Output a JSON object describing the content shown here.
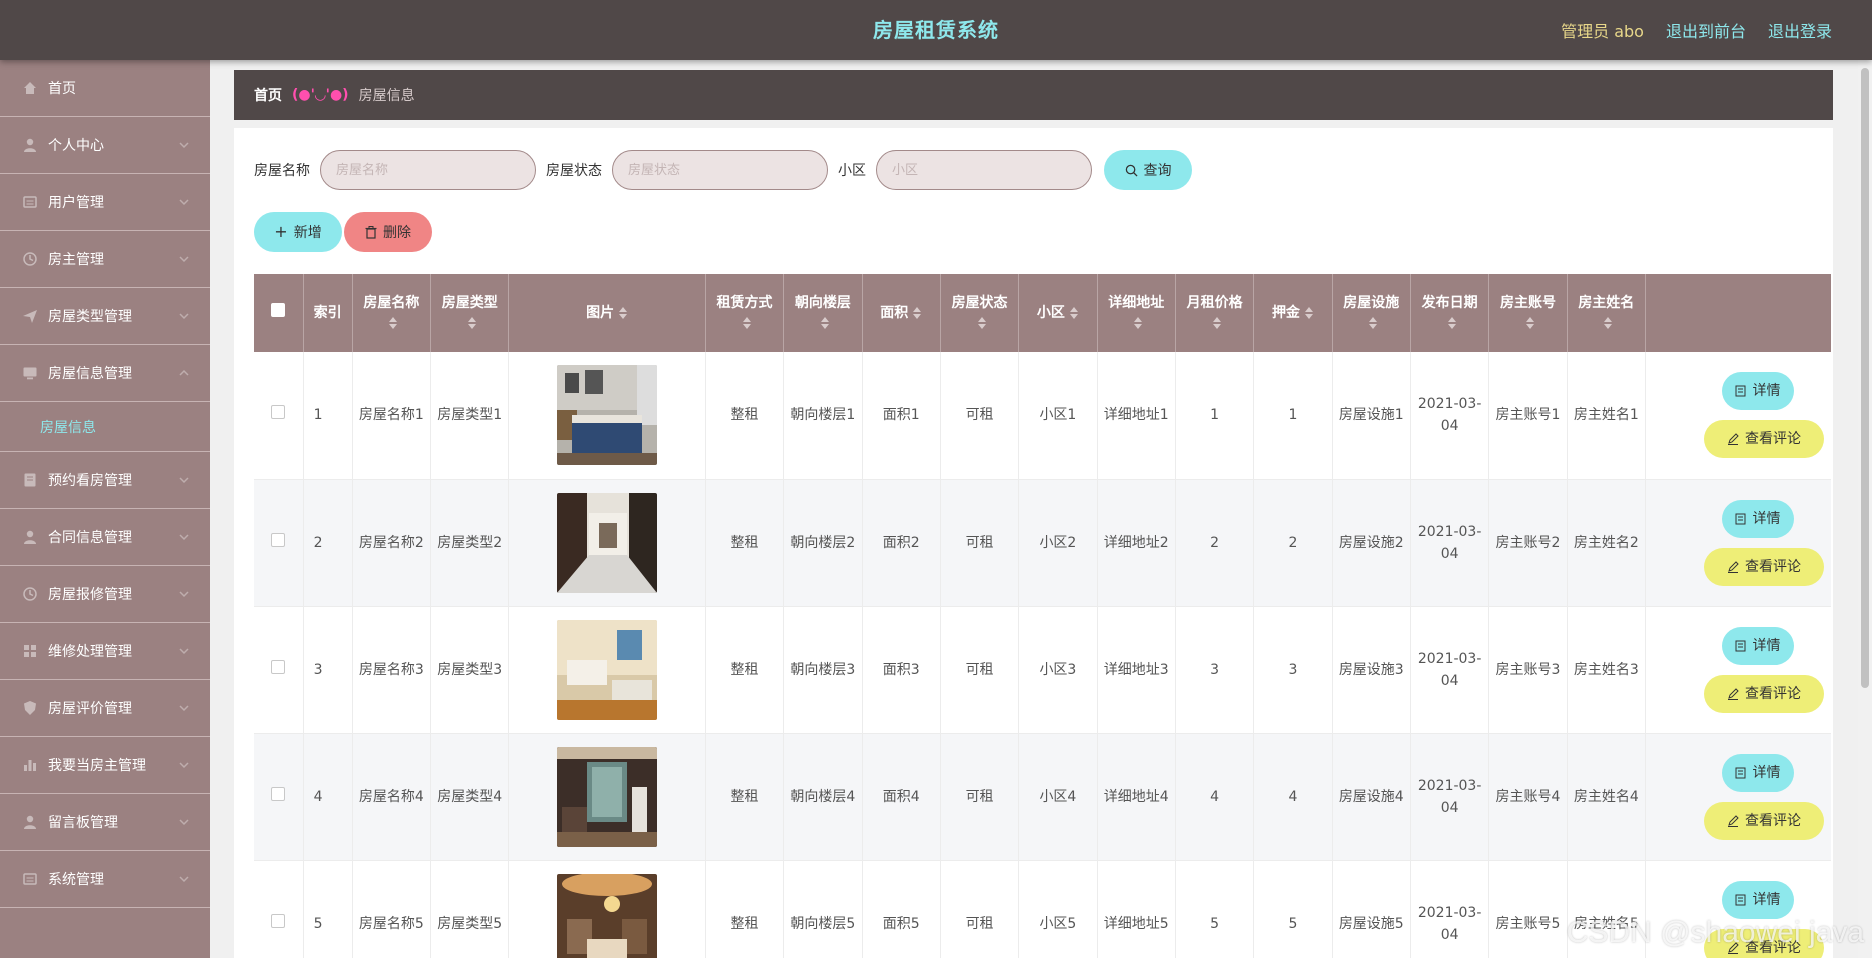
{
  "header": {
    "title": "房屋租赁系统",
    "admin_role": "管理员",
    "admin_name": "abo",
    "link_front": "退出到前台",
    "link_logout": "退出登录"
  },
  "colors": {
    "header_bg": "#504848",
    "accent_cyan": "#8ee8ec",
    "sidebar_bg": "#9b8181",
    "delete_red": "#f08585",
    "review_yellow": "#eeee77"
  },
  "sidebar": {
    "items": [
      {
        "label": "首页",
        "icon": "home-icon"
      },
      {
        "label": "个人中心",
        "icon": "user-icon"
      },
      {
        "label": "用户管理",
        "icon": "list-icon"
      },
      {
        "label": "房主管理",
        "icon": "clock-icon"
      },
      {
        "label": "房屋类型管理",
        "icon": "send-icon"
      },
      {
        "label": "房屋信息管理",
        "icon": "monitor-icon",
        "sub": "房屋信息"
      },
      {
        "label": "预约看房管理",
        "icon": "book-icon"
      },
      {
        "label": "合同信息管理",
        "icon": "user-icon"
      },
      {
        "label": "房屋报修管理",
        "icon": "clock-icon"
      },
      {
        "label": "维修处理管理",
        "icon": "grid-icon"
      },
      {
        "label": "房屋评价管理",
        "icon": "shield-icon"
      },
      {
        "label": "我要当房主管理",
        "icon": "bar-chart-icon"
      },
      {
        "label": "留言板管理",
        "icon": "user-icon"
      },
      {
        "label": "系统管理",
        "icon": "list-icon"
      }
    ]
  },
  "breadcrumb": {
    "home": "首页",
    "separator": "(●'◡'●)",
    "current": "房屋信息"
  },
  "search": {
    "name_label": "房屋名称",
    "name_placeholder": "房屋名称",
    "status_label": "房屋状态",
    "status_placeholder": "房屋状态",
    "community_label": "小区",
    "community_placeholder": "小区",
    "query_label": "查询"
  },
  "actions": {
    "add_label": "新增",
    "delete_label": "删除"
  },
  "table": {
    "headers": [
      "索引",
      "房屋名称",
      "房屋类型",
      "图片",
      "租赁方式",
      "朝向楼层",
      "面积",
      "房屋状态",
      "小区",
      "详细地址",
      "月租价格",
      "押金",
      "房屋设施",
      "发布日期",
      "房主账号",
      "房主姓名"
    ],
    "detail_label": "详情",
    "review_label": "查看评论",
    "rows": [
      {
        "index": "1",
        "name": "房屋名称1",
        "type": "房屋类型1",
        "image": "bedroom",
        "rent": "整租",
        "floor": "朝向楼层1",
        "area": "面积1",
        "status": "可租",
        "community": "小区1",
        "address": "详细地址1",
        "price": "1",
        "deposit": "1",
        "facility": "房屋设施1",
        "date": "2021-03-04",
        "owner_account": "房主账号1",
        "owner_name": "房主姓名1"
      },
      {
        "index": "2",
        "name": "房屋名称2",
        "type": "房屋类型2",
        "image": "hallway",
        "rent": "整租",
        "floor": "朝向楼层2",
        "area": "面积2",
        "status": "可租",
        "community": "小区2",
        "address": "详细地址2",
        "price": "2",
        "deposit": "2",
        "facility": "房屋设施2",
        "date": "2021-03-04",
        "owner_account": "房主账号2",
        "owner_name": "房主姓名2"
      },
      {
        "index": "3",
        "name": "房屋名称3",
        "type": "房屋类型3",
        "image": "hotel-room",
        "rent": "整租",
        "floor": "朝向楼层3",
        "area": "面积3",
        "status": "可租",
        "community": "小区3",
        "address": "详细地址3",
        "price": "3",
        "deposit": "3",
        "facility": "房屋设施3",
        "date": "2021-03-04",
        "owner_account": "房主账号3",
        "owner_name": "房主姓名3"
      },
      {
        "index": "4",
        "name": "房屋名称4",
        "type": "房屋类型4",
        "image": "living-room",
        "rent": "整租",
        "floor": "朝向楼层4",
        "area": "面积4",
        "status": "可租",
        "community": "小区4",
        "address": "详细地址4",
        "price": "4",
        "deposit": "4",
        "facility": "房屋设施4",
        "date": "2021-03-04",
        "owner_account": "房主账号4",
        "owner_name": "房主姓名4"
      },
      {
        "index": "5",
        "name": "房屋名称5",
        "type": "房屋类型5",
        "image": "chandelier-room",
        "rent": "整租",
        "floor": "朝向楼层5",
        "area": "面积5",
        "status": "可租",
        "community": "小区5",
        "address": "详细地址5",
        "price": "5",
        "deposit": "5",
        "facility": "房屋设施5",
        "date": "2021-03-04",
        "owner_account": "房主账号5",
        "owner_name": "房主姓名5"
      }
    ]
  },
  "watermark": "CSDN @shaowei java"
}
